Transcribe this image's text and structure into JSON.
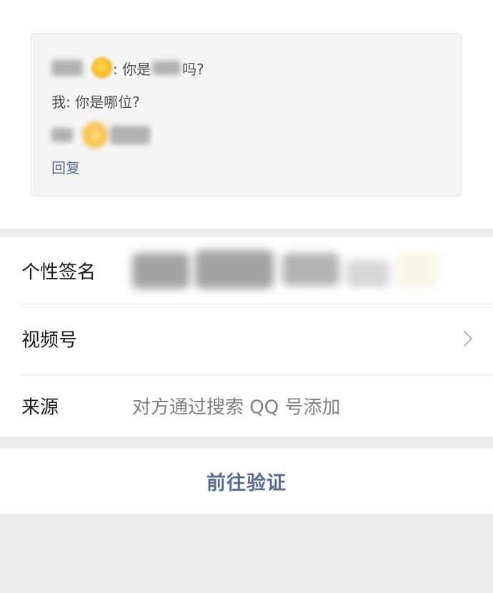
{
  "message": {
    "line1_text": ": 你是",
    "line1_suffix": "吗?",
    "line2_text": "我: 你是哪位?",
    "reply_label": "回复"
  },
  "profile": {
    "signature_label": "个性签名",
    "channel_label": "视频号",
    "source_label": "来源",
    "source_value": "对方通过搜索 QQ 号添加"
  },
  "actions": {
    "verify_label": "前往验证"
  },
  "icons": {
    "chevron": "chevron-right-icon",
    "emoji": "emoji-icon"
  },
  "colors": {
    "link": "#576b95",
    "page_background": "#ededed",
    "card_background": "#f5f5f5"
  }
}
